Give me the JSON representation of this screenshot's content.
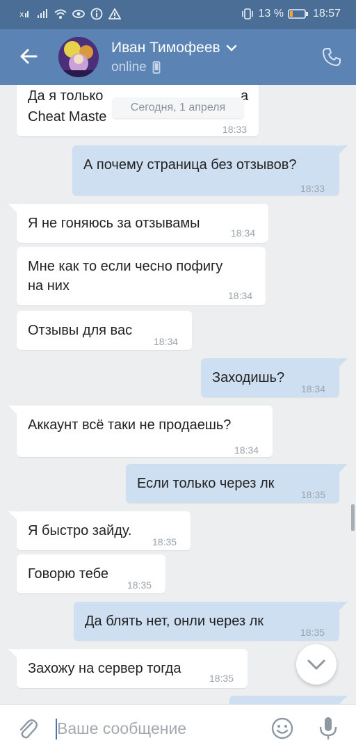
{
  "status_bar": {
    "battery": "13 %",
    "time": "18:57"
  },
  "header": {
    "contact_name": "Иван Тимофеев",
    "contact_status": "online"
  },
  "date_badge": "Сегодня, 1 апреля",
  "messages": [
    {
      "dir": "in",
      "line1": "Да я только",
      "line1_tail": "а",
      "line2": "Cheat Maste",
      "time": "18:33"
    },
    {
      "dir": "out",
      "text": "А почему страница без отзывов?",
      "time": "18:33"
    },
    {
      "dir": "in",
      "text": "Я не гоняюсь за отзывамы",
      "time": "18:34"
    },
    {
      "dir": "in",
      "line1": "Мне как то если чесно пофигу",
      "line2": "на них",
      "time": "18:34"
    },
    {
      "dir": "in",
      "text": "Отзывы для вас",
      "time": "18:34"
    },
    {
      "dir": "out",
      "text": "Заходишь?",
      "time": "18:34"
    },
    {
      "dir": "in",
      "text": "Аккаунт всё таки не продаешь?",
      "time": "18:34"
    },
    {
      "dir": "out",
      "text": "Если только через лк",
      "time": "18:35"
    },
    {
      "dir": "in",
      "text": "Я быстро зайду.",
      "time": "18:35"
    },
    {
      "dir": "in",
      "text": "Говорю тебе",
      "time": "18:35"
    },
    {
      "dir": "out",
      "text": "Да блять нет, онли через лк",
      "time": "18:35"
    },
    {
      "dir": "in",
      "text": "Захожу на сервер тогда",
      "time": "18:35"
    }
  ],
  "input": {
    "placeholder": "Ваше сообщение"
  },
  "colors": {
    "statusbar": "#4a6e96",
    "header": "#5b84b5",
    "chat_bg": "#edeef0",
    "outgoing_bubble": "#cfdff2",
    "incoming_bubble": "#ffffff"
  }
}
